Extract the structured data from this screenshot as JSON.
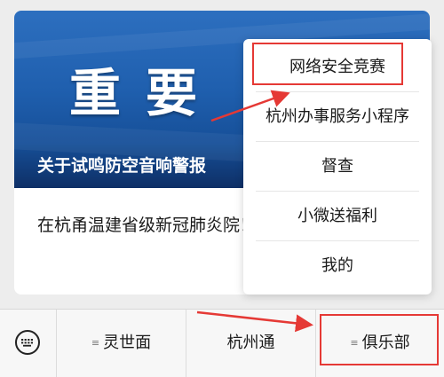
{
  "article": {
    "banner_big_text": "重要",
    "banner_title": "关于试鸣防空音响警报",
    "summary": "在杭甬温建省级新冠肺炎院！学校疫情防控有何新"
  },
  "menu": {
    "items": [
      {
        "label": "网络安全竞赛"
      },
      {
        "label": "杭州办事服务小程序"
      },
      {
        "label": "督查"
      },
      {
        "label": "小微送福利"
      },
      {
        "label": "我的"
      }
    ]
  },
  "bottom_bar": {
    "keyboard_icon": "keyboard-icon",
    "tabs": [
      {
        "label": "灵世面",
        "menu_icon": "≡"
      },
      {
        "label": "杭州通",
        "menu_icon": ""
      },
      {
        "label": "俱乐部",
        "menu_icon": "≡"
      }
    ]
  },
  "annotation_color": "#e53935"
}
